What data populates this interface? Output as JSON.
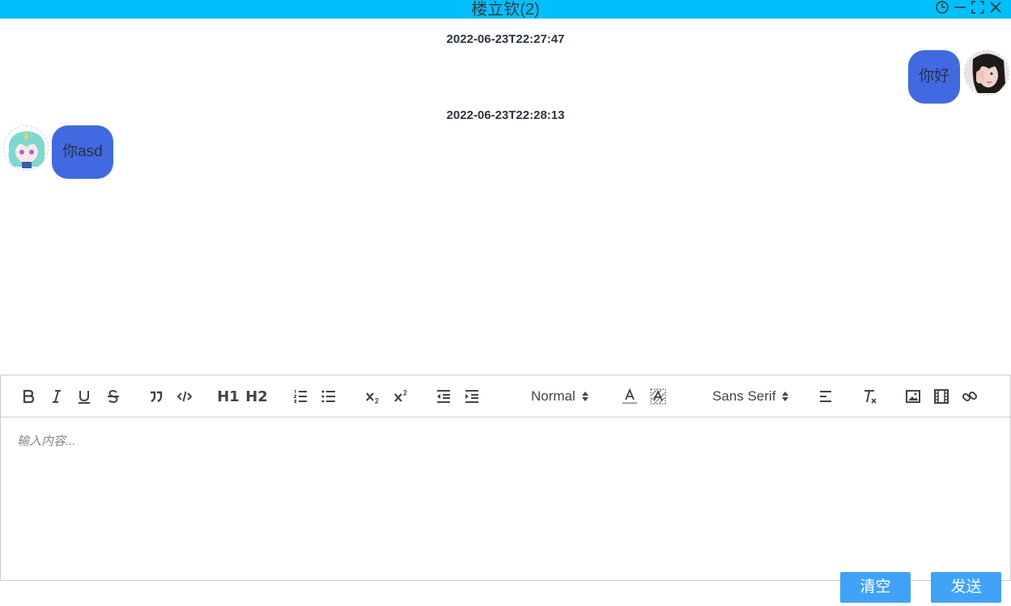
{
  "window": {
    "title": "楼立钦(2)"
  },
  "messages": [
    {
      "time": "2022-06-23T22:27:47",
      "text": "你好",
      "side": "right"
    },
    {
      "time": "2022-06-23T22:28:13",
      "text": "你asd",
      "side": "left"
    }
  ],
  "toolbar": {
    "header1": "H1",
    "header2": "H2",
    "size_picker": "Normal",
    "font_picker": "Sans Serif"
  },
  "editor": {
    "placeholder": "输入内容..."
  },
  "actions": {
    "clear_label": "清空",
    "send_label": "发送"
  },
  "colors": {
    "titlebar": "#00bfff",
    "bubble": "#4169e1",
    "button": "#40a3f8"
  }
}
